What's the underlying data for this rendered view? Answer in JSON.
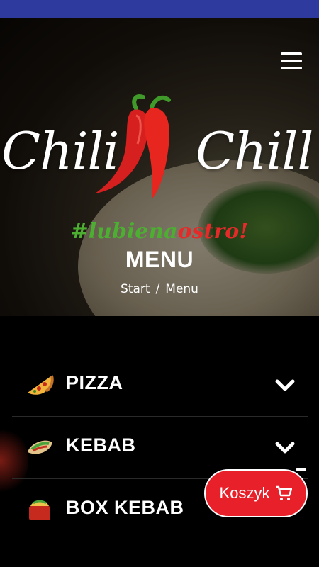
{
  "brand": {
    "left": "Chili",
    "right": "Chill",
    "tagline_green": "#lubie",
    "tagline_mid": "na",
    "tagline_red": "ostro!"
  },
  "page": {
    "title": "MENU"
  },
  "breadcrumb": {
    "items": [
      "Start",
      "Menu"
    ],
    "separator": "/"
  },
  "menu": {
    "items": [
      {
        "label": "PIZZA",
        "icon": "pizza-slice-icon"
      },
      {
        "label": "KEBAB",
        "icon": "kebab-wrap-icon"
      },
      {
        "label": "BOX KEBAB",
        "icon": "box-kebab-icon"
      }
    ]
  },
  "cart": {
    "label": "Koszyk",
    "icon": "cart-icon"
  },
  "colors": {
    "statusbar": "#2f3a9e",
    "accent": "#e8202a",
    "green": "#4caf32",
    "background": "#000000"
  }
}
